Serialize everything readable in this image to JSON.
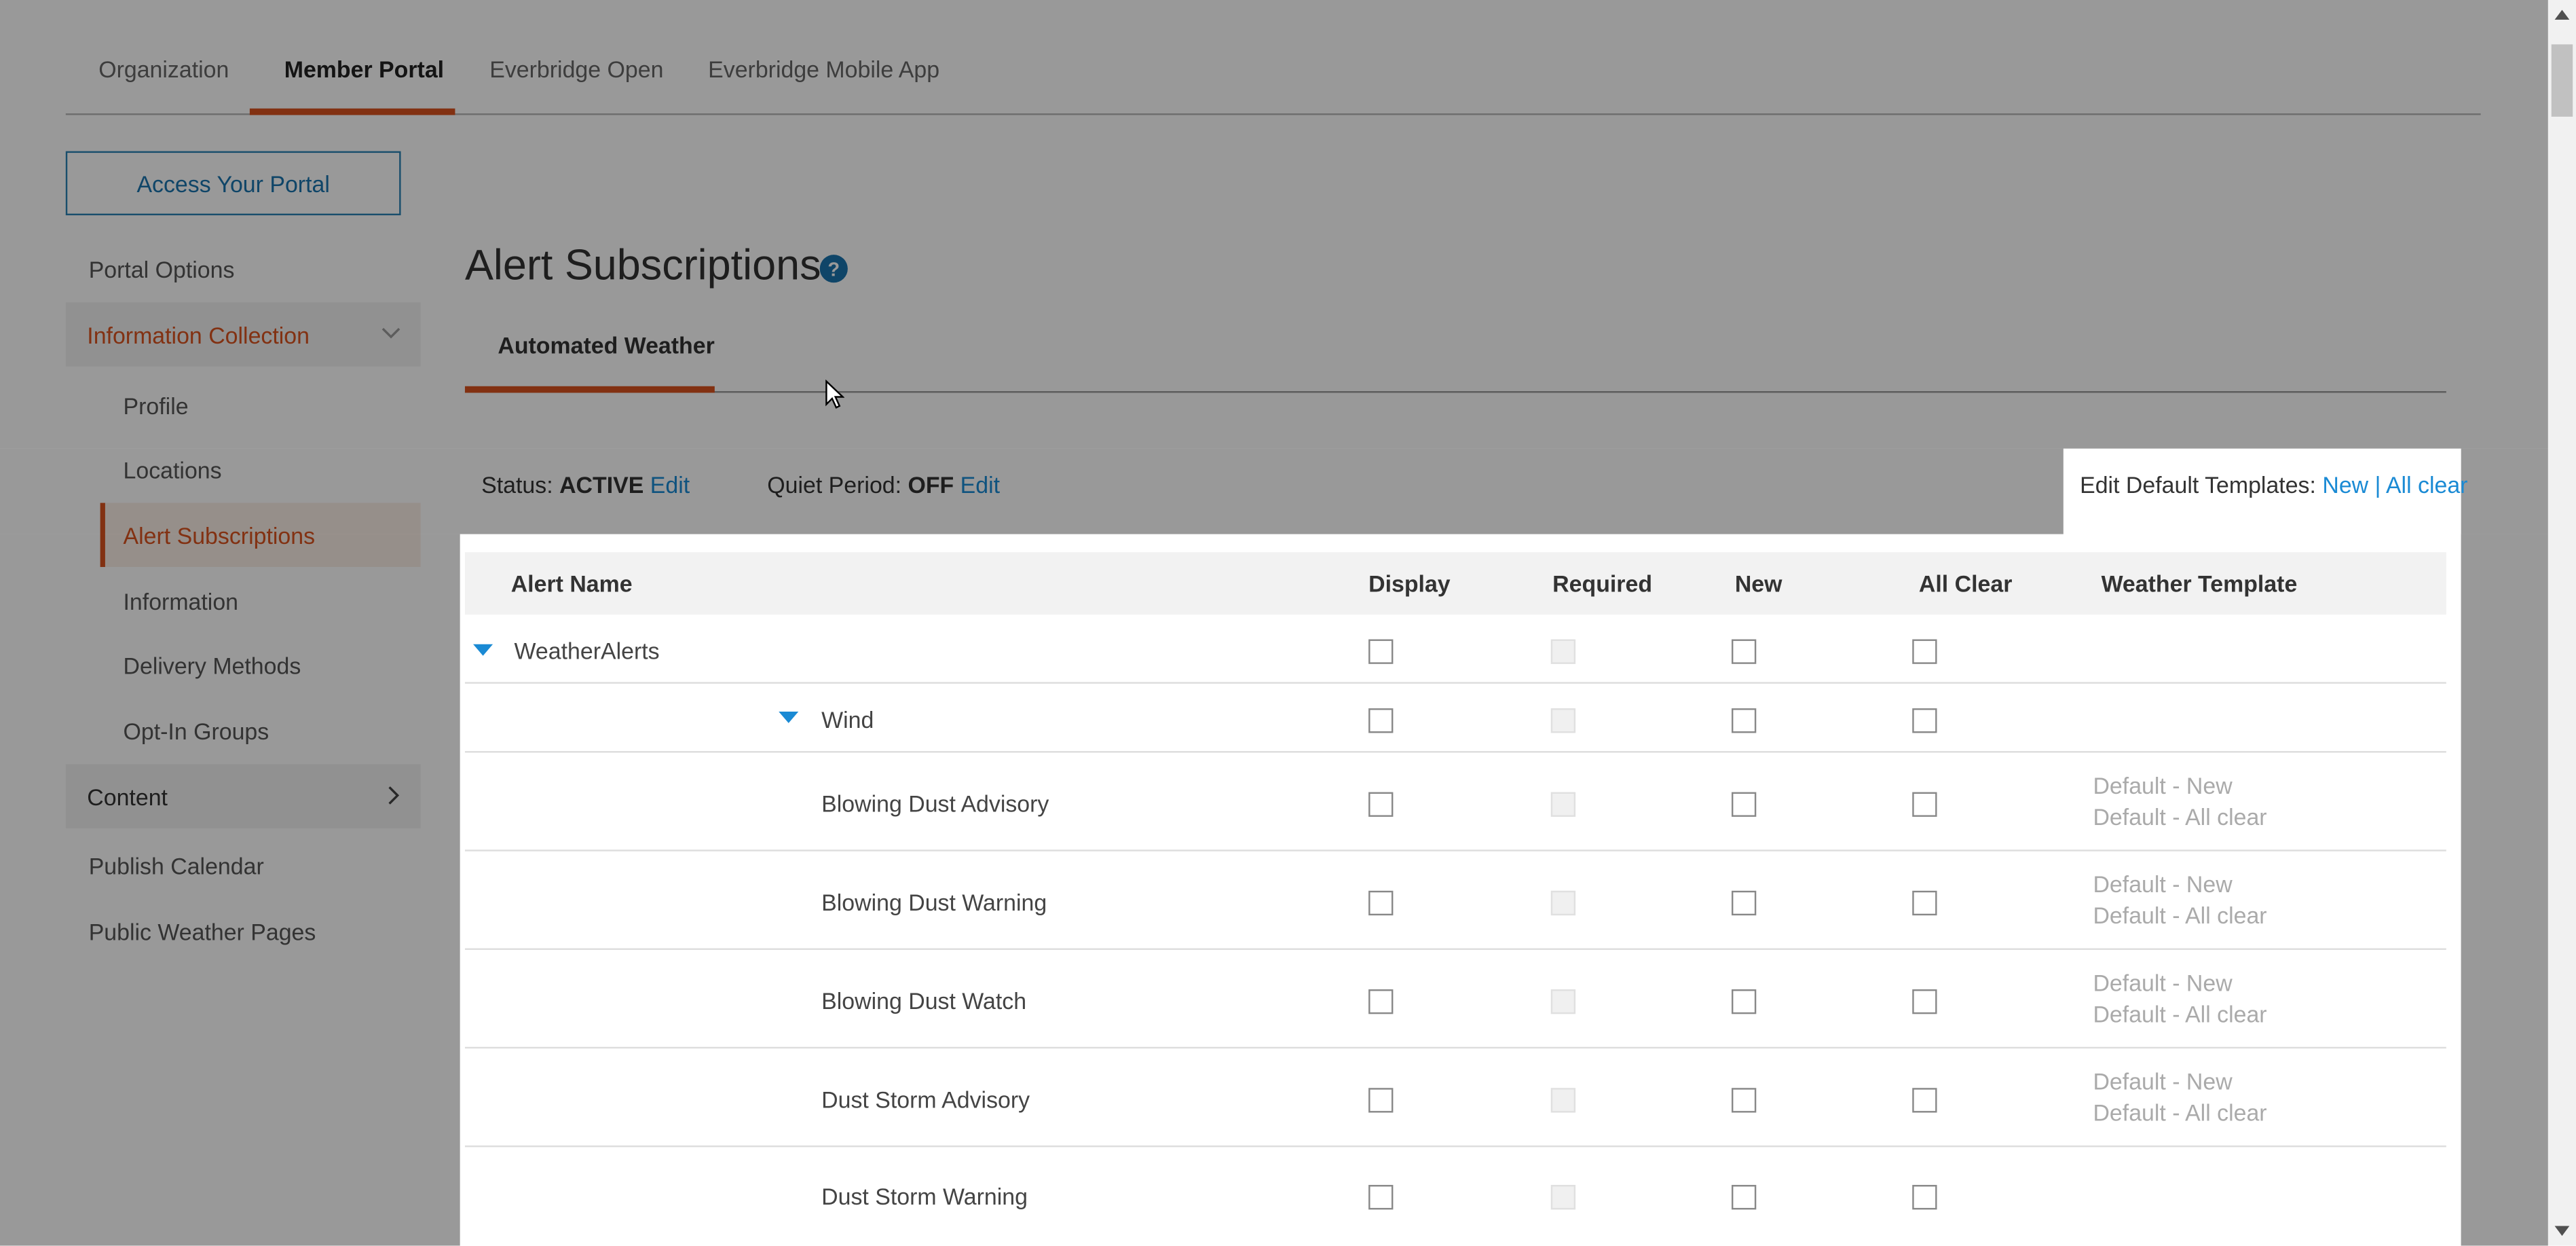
{
  "top_tabs": [
    {
      "label": "Organization"
    },
    {
      "label": "Member Portal"
    },
    {
      "label": "Everbridge Open"
    },
    {
      "label": "Everbridge Mobile App"
    }
  ],
  "sidebar": {
    "portal_button": "Access Your Portal",
    "items": [
      {
        "label": "Portal Options"
      },
      {
        "label": "Information Collection"
      },
      {
        "label": "Profile"
      },
      {
        "label": "Locations"
      },
      {
        "label": "Alert Subscriptions"
      },
      {
        "label": "Information"
      },
      {
        "label": "Delivery Methods"
      },
      {
        "label": "Opt-In Groups"
      },
      {
        "label": "Content"
      },
      {
        "label": "Publish Calendar"
      },
      {
        "label": "Public Weather Pages"
      }
    ]
  },
  "main": {
    "title": "Alert Subscriptions",
    "help_glyph": "?",
    "tab": "Automated Weather",
    "status_label": "Status:",
    "status_value": "ACTIVE",
    "status_edit": "Edit",
    "quiet_label": "Quiet Period:",
    "quiet_value": "OFF",
    "quiet_edit": "Edit",
    "templates_label": "Edit Default Templates:",
    "templates_new": "New",
    "templates_sep": "|",
    "templates_allclear": "All clear"
  },
  "table": {
    "headers": [
      "Alert Name",
      "Display",
      "Required",
      "New",
      "All Clear",
      "Weather Template"
    ],
    "rows": [
      {
        "name": "WeatherAlerts",
        "template_new": "",
        "template_clear": ""
      },
      {
        "name": "Wind",
        "template_new": "",
        "template_clear": ""
      },
      {
        "name": "Blowing Dust Advisory",
        "template_new": "Default - New",
        "template_clear": "Default - All clear"
      },
      {
        "name": "Blowing Dust Warning",
        "template_new": "Default - New",
        "template_clear": "Default - All clear"
      },
      {
        "name": "Blowing Dust Watch",
        "template_new": "Default - New",
        "template_clear": "Default - All clear"
      },
      {
        "name": "Dust Storm Advisory",
        "template_new": "Default - New",
        "template_clear": "Default - All clear"
      },
      {
        "name": "Dust Storm Warning",
        "template_new": "",
        "template_clear": ""
      }
    ]
  },
  "colors": {
    "accent_orange": "#d9531e",
    "link_blue": "#1a8ad4",
    "overlay": "rgba(0,0,0,0.40)"
  }
}
